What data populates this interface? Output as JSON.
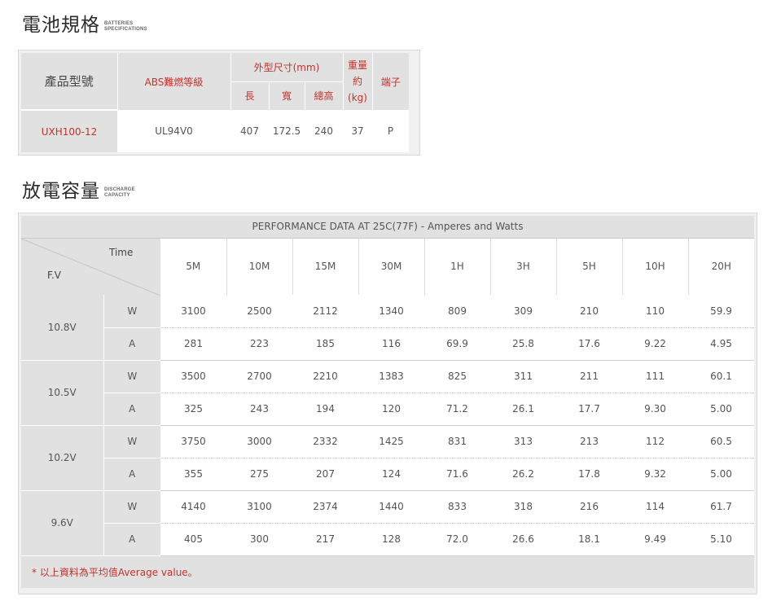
{
  "specs_section": {
    "title": "電池規格",
    "subtitle_line1": "BATTERIES",
    "subtitle_line2": "SPECIFICATIONS"
  },
  "spec_table": {
    "headers": {
      "model": "產品型號",
      "abs": "ABS難燃等級",
      "dimensions": "外型尺寸(mm)",
      "length": "長",
      "width": "寬",
      "height": "總高",
      "weight": "重量約(kg)",
      "terminal": "端子"
    },
    "row": {
      "model": "UXH100-12",
      "abs": "UL94V0",
      "length": "407",
      "width": "172.5",
      "height": "240",
      "weight": "37",
      "terminal": "P"
    }
  },
  "discharge_section": {
    "title": "放電容量",
    "subtitle_line1": "DISCHARGE",
    "subtitle_line2": "CAPACITY"
  },
  "perf_table": {
    "caption": "PERFORMANCE DATA AT 25C(77F) - Amperes and Watts",
    "corner_time": "Time",
    "corner_fv": "F.V",
    "columns": [
      "5M",
      "10M",
      "15M",
      "30M",
      "1H",
      "3H",
      "5H",
      "10H",
      "20H"
    ],
    "groups": [
      {
        "voltage": "10.8V",
        "rows": [
          {
            "unit": "W",
            "values": [
              "3100",
              "2500",
              "2112",
              "1340",
              "809",
              "309",
              "210",
              "110",
              "59.9"
            ]
          },
          {
            "unit": "A",
            "values": [
              "281",
              "223",
              "185",
              "116",
              "69.9",
              "25.8",
              "17.6",
              "9.22",
              "4.95"
            ]
          }
        ]
      },
      {
        "voltage": "10.5V",
        "rows": [
          {
            "unit": "W",
            "values": [
              "3500",
              "2700",
              "2210",
              "1383",
              "825",
              "311",
              "211",
              "111",
              "60.1"
            ]
          },
          {
            "unit": "A",
            "values": [
              "325",
              "243",
              "194",
              "120",
              "71.2",
              "26.1",
              "17.7",
              "9.30",
              "5.00"
            ]
          }
        ]
      },
      {
        "voltage": "10.2V",
        "rows": [
          {
            "unit": "W",
            "values": [
              "3750",
              "3000",
              "2332",
              "1425",
              "831",
              "313",
              "213",
              "112",
              "60.5"
            ]
          },
          {
            "unit": "A",
            "values": [
              "355",
              "275",
              "207",
              "124",
              "71.6",
              "26.2",
              "17.8",
              "9.32",
              "5.00"
            ]
          }
        ]
      },
      {
        "voltage": "9.6V",
        "rows": [
          {
            "unit": "W",
            "values": [
              "4140",
              "3100",
              "2374",
              "1440",
              "833",
              "318",
              "216",
              "114",
              "61.7"
            ]
          },
          {
            "unit": "A",
            "values": [
              "405",
              "300",
              "217",
              "128",
              "72.0",
              "26.6",
              "18.1",
              "9.49",
              "5.10"
            ]
          }
        ]
      }
    ],
    "note": "* 以上資料為平均值Average value。"
  },
  "colors": {
    "accent_red": "#c2322d",
    "header_gray": "#e1e1e1",
    "frame_gray": "#f0f0f0"
  }
}
